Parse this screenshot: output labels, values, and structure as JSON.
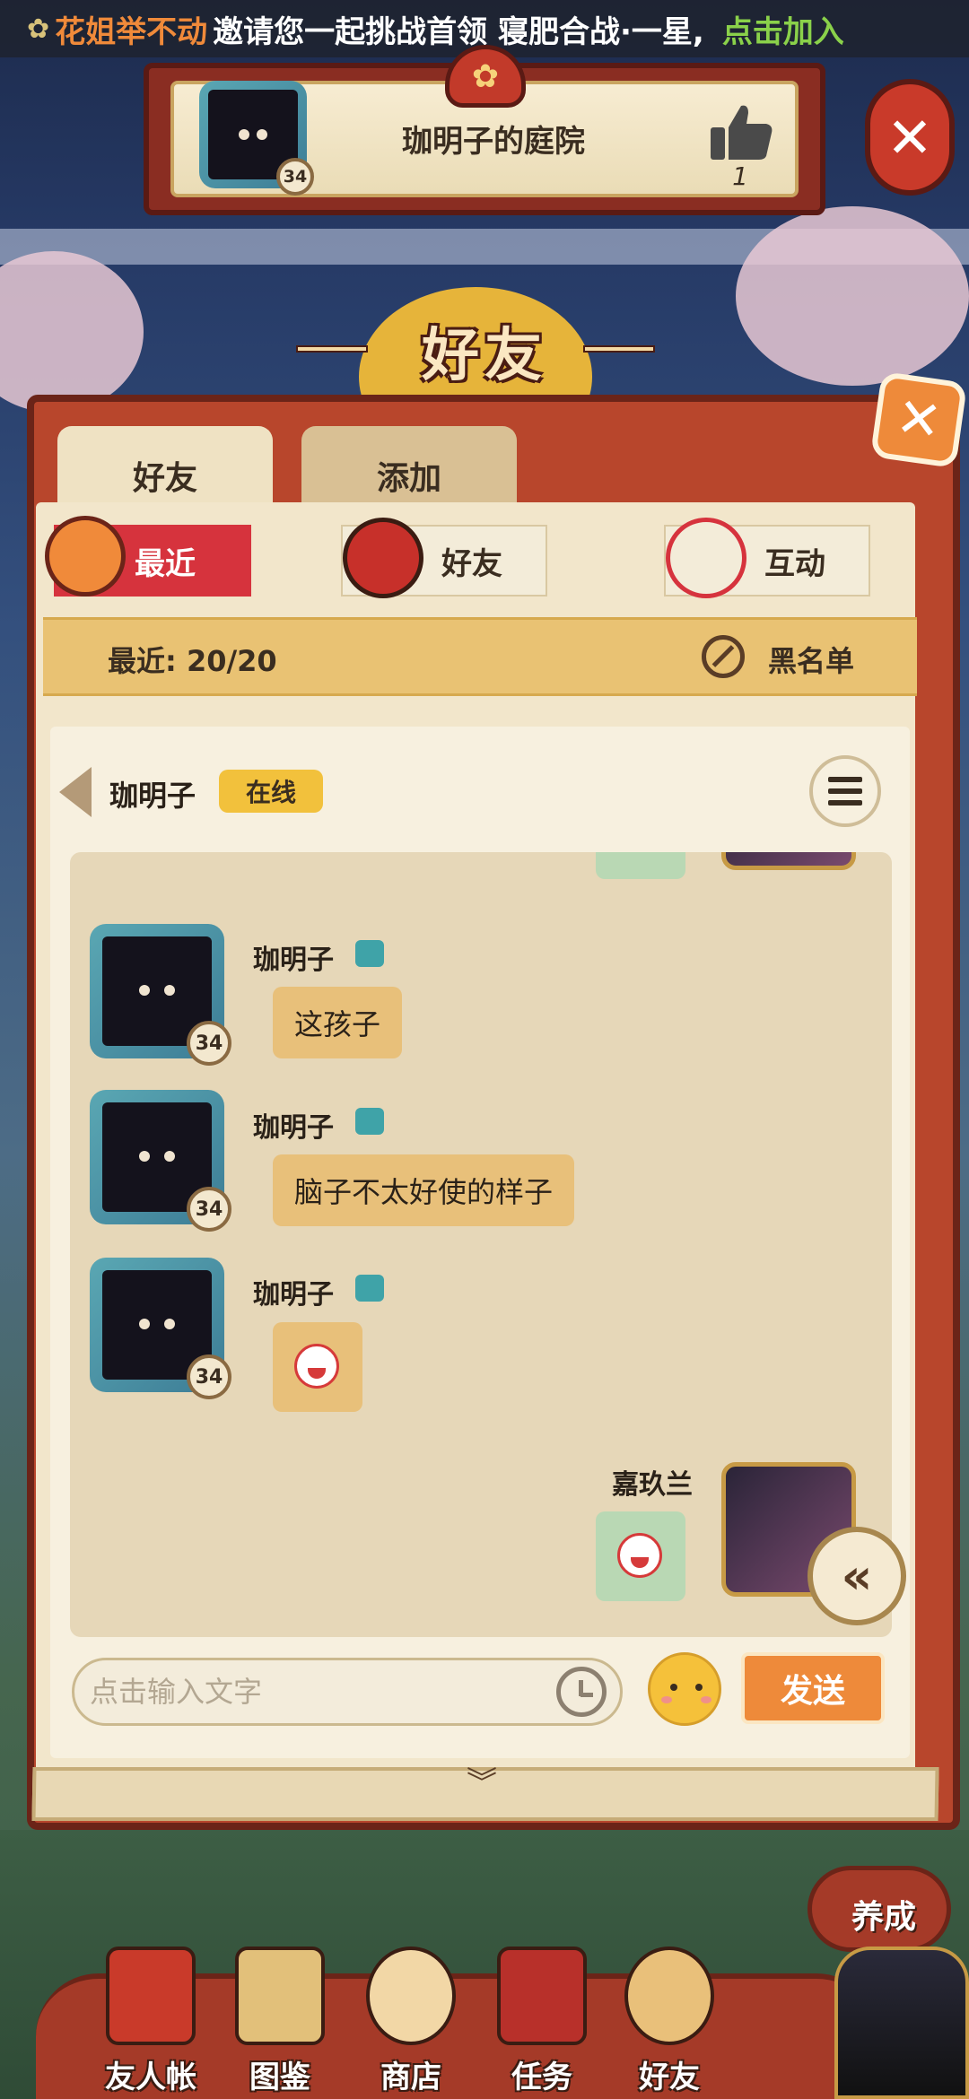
{
  "marquee": {
    "inviter": "花姐举不动",
    "message": "邀请您一起挑战首领 寝肥合战·一星,",
    "join_label": "点击加入"
  },
  "banner": {
    "title": "珈明子的庭院",
    "avatar_level": "34",
    "like_count": "1"
  },
  "page_title": "好友",
  "tabs": [
    {
      "label": "好友",
      "active": true
    },
    {
      "label": "添加",
      "active": false
    }
  ],
  "subtabs": [
    {
      "label": "最近",
      "active": true
    },
    {
      "label": "好友",
      "active": false
    },
    {
      "label": "互动",
      "active": false
    }
  ],
  "infobar": {
    "recent_label": "最近: 20/20",
    "blacklist_label": "黑名单"
  },
  "chat": {
    "partner_name": "珈明子",
    "status": "在线",
    "messages": [
      {
        "sender": "珈明子",
        "level": "34",
        "text": "这孩子"
      },
      {
        "sender": "珈明子",
        "level": "34",
        "text": "脑子不太好使的样子"
      },
      {
        "sender": "珈明子",
        "level": "34",
        "emoji": "crying-chicken"
      }
    ],
    "my_message": {
      "sender": "嘉玖兰",
      "emoji": "crying-chicken"
    },
    "input_placeholder": "点击输入文字",
    "send_label": "发送"
  },
  "bottom_nav": [
    {
      "label": "友人帐"
    },
    {
      "label": "图鉴"
    },
    {
      "label": "商店"
    },
    {
      "label": "任务"
    },
    {
      "label": "好友"
    }
  ],
  "raise_label": "养成",
  "colors": {
    "accent_orange": "#ee8a3a",
    "recent_tab_red": "#d6333d",
    "online_yellow": "#f2c13c",
    "incoming_bubble": "#e8c07a",
    "outgoing_bubble": "#b9d8b4",
    "join_green": "#8ad14a"
  }
}
